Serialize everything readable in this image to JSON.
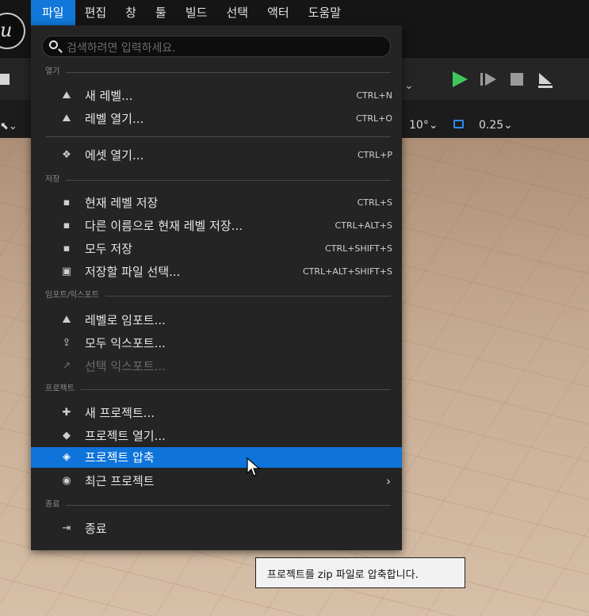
{
  "menubar": {
    "items": [
      {
        "label": "파일",
        "active": true
      },
      {
        "label": "편집"
      },
      {
        "label": "창"
      },
      {
        "label": "툴"
      },
      {
        "label": "빌드"
      },
      {
        "label": "선택"
      },
      {
        "label": "액터"
      },
      {
        "label": "도움말"
      }
    ]
  },
  "viewport_toolbar": {
    "rotation_snap": "10°",
    "scale_snap": "0.25"
  },
  "dropdown": {
    "search_placeholder": "검색하려면 입력하세요.",
    "sections": {
      "open": "열기",
      "save": "저장",
      "import_export": "임포트/익스포트",
      "project": "프로젝트",
      "exit": "종료"
    },
    "items": {
      "new_level": {
        "label": "새 레벨...",
        "shortcut": "CTRL+N",
        "icon": "new-level-icon"
      },
      "open_level": {
        "label": "레벨 열기...",
        "shortcut": "CTRL+O",
        "icon": "open-level-icon"
      },
      "open_asset": {
        "label": "에셋 열기...",
        "shortcut": "CTRL+P",
        "icon": "asset-icon"
      },
      "save_current": {
        "label": "현재 레벨 저장",
        "shortcut": "CTRL+S",
        "icon": "save-icon"
      },
      "save_as": {
        "label": "다른 이름으로 현재 레벨 저장...",
        "shortcut": "CTRL+ALT+S",
        "icon": "save-as-icon"
      },
      "save_all": {
        "label": "모두 저장",
        "shortcut": "CTRL+SHIFT+S",
        "icon": "save-all-icon"
      },
      "choose_files": {
        "label": "저장할 파일 선택...",
        "shortcut": "CTRL+ALT+SHIFT+S",
        "icon": "choose-files-icon"
      },
      "import_level": {
        "label": "레벨로 임포트...",
        "icon": "import-icon"
      },
      "export_all": {
        "label": "모두 익스포트...",
        "icon": "export-icon"
      },
      "export_selected": {
        "label": "선택 익스포트...",
        "icon": "export-selected-icon",
        "disabled": true
      },
      "new_project": {
        "label": "새 프로젝트...",
        "icon": "new-project-icon"
      },
      "open_project": {
        "label": "프로젝트 열기...",
        "icon": "open-project-icon"
      },
      "zip_project": {
        "label": "프로젝트 압축",
        "icon": "zip-project-icon",
        "highlighted": true
      },
      "recent_projects": {
        "label": "최근 프로젝트",
        "icon": "recent-projects-icon",
        "has_submenu": true
      },
      "exit": {
        "label": "종료",
        "icon": "exit-icon"
      }
    }
  },
  "tooltip": {
    "text": "프로젝트를 zip 파일로 압축합니다."
  },
  "colors": {
    "accent": "#0f74d9",
    "play_green": "#3ec85a",
    "menu_bg": "#242424"
  }
}
